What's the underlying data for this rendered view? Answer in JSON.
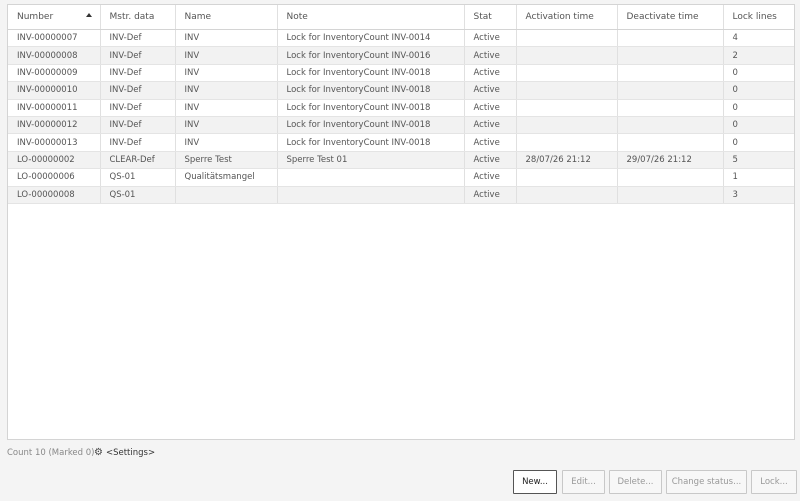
{
  "table": {
    "columns": [
      "Number",
      "Mstr. data",
      "Name",
      "Note",
      "Stat",
      "Activation time",
      "Deactivate time",
      "Lock lines"
    ],
    "rows": [
      [
        "INV-00000007",
        "INV-Def",
        "INV",
        "Lock for InventoryCount INV-0014",
        "Active",
        "",
        "",
        "4"
      ],
      [
        "INV-00000008",
        "INV-Def",
        "INV",
        "Lock for InventoryCount INV-0016",
        "Active",
        "",
        "",
        "2"
      ],
      [
        "INV-00000009",
        "INV-Def",
        "INV",
        "Lock for InventoryCount INV-0018",
        "Active",
        "",
        "",
        "0"
      ],
      [
        "INV-00000010",
        "INV-Def",
        "INV",
        "Lock for InventoryCount INV-0018",
        "Active",
        "",
        "",
        "0"
      ],
      [
        "INV-00000011",
        "INV-Def",
        "INV",
        "Lock for InventoryCount INV-0018",
        "Active",
        "",
        "",
        "0"
      ],
      [
        "INV-00000012",
        "INV-Def",
        "INV",
        "Lock for InventoryCount INV-0018",
        "Active",
        "",
        "",
        "0"
      ],
      [
        "INV-00000013",
        "INV-Def",
        "INV",
        "Lock for InventoryCount INV-0018",
        "Active",
        "",
        "",
        "0"
      ],
      [
        "LO-00000002",
        "CLEAR-Def",
        "Sperre Test",
        "Sperre Test 01",
        "Active",
        "28/07/26 21:12",
        "29/07/26 21:12",
        "5"
      ],
      [
        "LO-00000006",
        "QS-01",
        "Qualitätsmangel",
        "",
        "Active",
        "",
        "",
        "1"
      ],
      [
        "LO-00000008",
        "QS-01",
        "",
        "",
        "Active",
        "",
        "",
        "3"
      ]
    ],
    "sort_column": "Number",
    "sort_direction": "ascending"
  },
  "footer": {
    "count_text": "Count 10 (Marked 0)",
    "settings_label": "<Settings>",
    "settings_icon": "gear-icon"
  },
  "buttons": {
    "new": "New...",
    "edit": "Edit...",
    "delete": "Delete...",
    "change_status": "Change status...",
    "lock": "Lock..."
  },
  "colors": {
    "alt_row": "#f2f2f2",
    "border": "#d4d4d4",
    "text": "#555555"
  }
}
